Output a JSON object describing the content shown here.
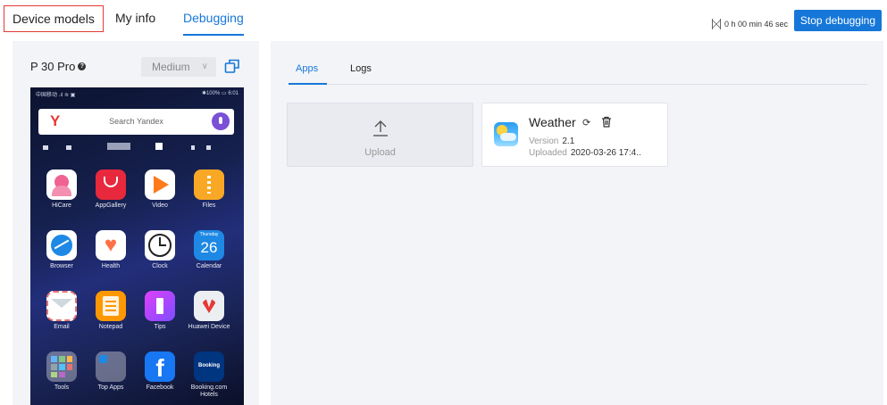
{
  "topnav": {
    "tabs": [
      {
        "label": "Device models"
      },
      {
        "label": "My info"
      },
      {
        "label": "Debugging"
      }
    ],
    "timer": "0 h 00 min 46 sec",
    "stop_label": "Stop debugging"
  },
  "device": {
    "name": "P 30 Pro",
    "help": "?",
    "size_selected": "Medium",
    "phone": {
      "status_left": "中国移动 .ıl ≋ ▣",
      "status_right": "✱100% ▭ 6:01",
      "search_placeholder": "Search Yandex",
      "search_logo": "Y",
      "apps": [
        {
          "label": "HiCare"
        },
        {
          "label": "AppGallery"
        },
        {
          "label": "Video"
        },
        {
          "label": "Files"
        },
        {
          "label": "Browser"
        },
        {
          "label": "Health"
        },
        {
          "label": "Clock"
        },
        {
          "label": "Calendar",
          "day": "Thursday",
          "date": "26"
        },
        {
          "label": "Email"
        },
        {
          "label": "Notepad"
        },
        {
          "label": "Tips"
        },
        {
          "label": "Huawei Device"
        },
        {
          "label": "Tools"
        },
        {
          "label": "Top Apps"
        },
        {
          "label": "Facebook"
        },
        {
          "label": "Booking.com Hotels",
          "badge": "Booking"
        }
      ]
    }
  },
  "panel": {
    "tabs": [
      {
        "label": "Apps"
      },
      {
        "label": "Logs"
      }
    ],
    "upload_label": "Upload",
    "app": {
      "name": "Weather",
      "version_label": "Version",
      "version": "2.1",
      "uploaded_label": "Uploaded",
      "uploaded": "2020-03-26 17:4.."
    }
  },
  "colors": {
    "accent": "#1677d9",
    "highlight_border": "#e53935",
    "panel_bg": "#f3f4f7"
  }
}
